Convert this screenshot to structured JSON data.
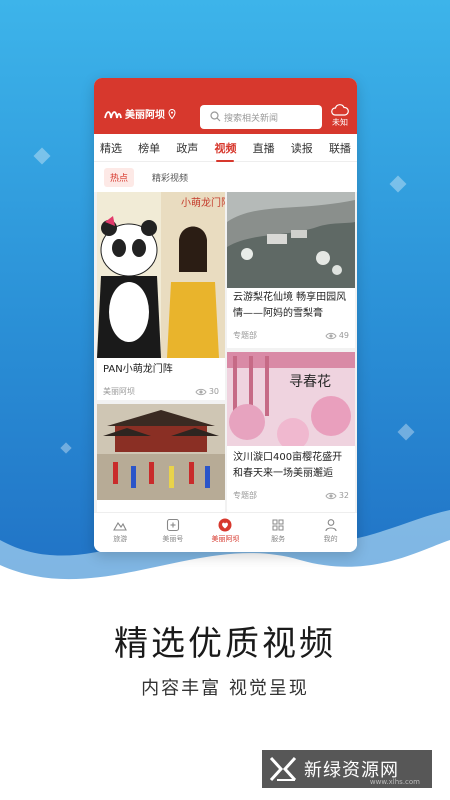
{
  "app": {
    "brand": "美丽阿坝",
    "search_placeholder": "搜索相关新闻",
    "weather_label": "未知"
  },
  "tabs": [
    "精选",
    "榜单",
    "政声",
    "视频",
    "直播",
    "读报",
    "联播"
  ],
  "active_tab": "视频",
  "subtabs": [
    "热点",
    "精彩视频"
  ],
  "active_subtab": "热点",
  "cards": [
    {
      "title": "PAN小萌龙门阵",
      "source": "美丽阿坝",
      "views": "30",
      "image_text": "小萌龙门阵"
    },
    {
      "title": "云游梨花仙境 畅享田园风情——阿妈的雪梨膏",
      "source": "专题部",
      "views": "49"
    },
    {
      "title": "",
      "source": "",
      "views": ""
    },
    {
      "title": "汶川漩口400亩樱花盛开和春天来一场美丽邂逅",
      "source": "专题部",
      "views": "32",
      "image_text": "寻春花"
    }
  ],
  "bottom_nav": [
    {
      "label": "旅游",
      "icon": "mountain-icon"
    },
    {
      "label": "美丽号",
      "icon": "plus-square-icon"
    },
    {
      "label": "美丽阿坝",
      "icon": "heart-icon"
    },
    {
      "label": "服务",
      "icon": "grid-icon"
    },
    {
      "label": "我的",
      "icon": "user-icon"
    }
  ],
  "active_nav": "美丽阿坝",
  "promo": {
    "headline": "精选优质视频",
    "subheadline": "内容丰富 视觉呈现"
  },
  "watermark": {
    "text": "新绿资源网",
    "url": "www.xlhs.com"
  },
  "colors": {
    "brand_red": "#d7382d",
    "sky_blue": "#3db4ea"
  }
}
